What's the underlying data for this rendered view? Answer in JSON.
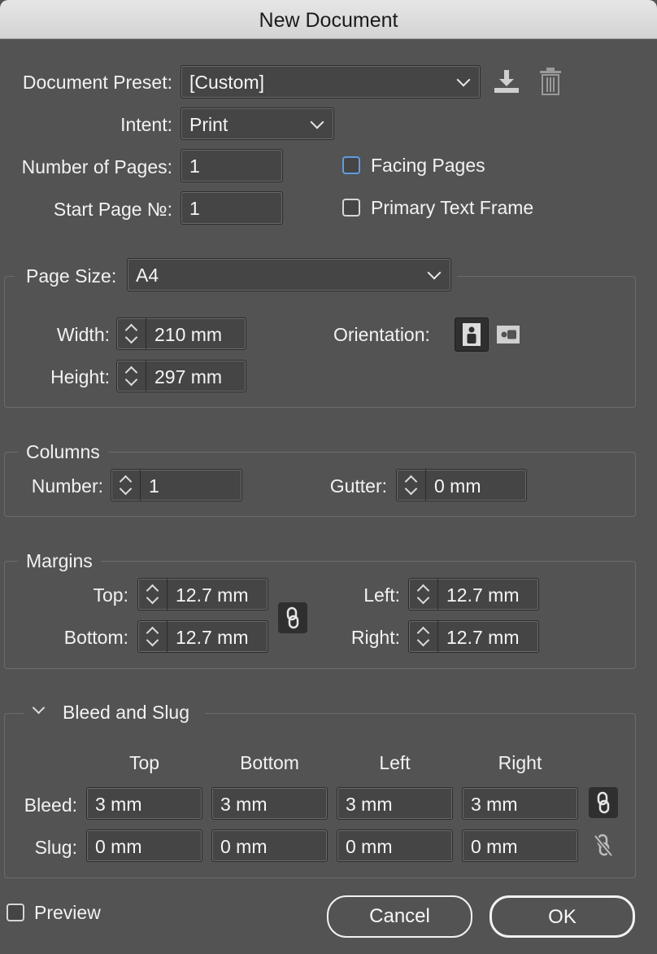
{
  "window": {
    "title": "New Document"
  },
  "preset": {
    "label": "Document Preset:",
    "value": "[Custom]",
    "save_icon": "save-preset-icon",
    "delete_icon": "trash-icon"
  },
  "intent": {
    "label": "Intent:",
    "value": "Print"
  },
  "pages": {
    "label": "Number of Pages:",
    "value": "1"
  },
  "start_page": {
    "label": "Start Page №:",
    "value": "1"
  },
  "facing_pages": {
    "label": "Facing Pages",
    "checked": false
  },
  "primary_text_frame": {
    "label": "Primary Text Frame",
    "checked": false
  },
  "page_size": {
    "label": "Page Size:",
    "value": "A4"
  },
  "width": {
    "label": "Width:",
    "value": "210 mm"
  },
  "height": {
    "label": "Height:",
    "value": "297 mm"
  },
  "orientation": {
    "label": "Orientation:",
    "selected": "portrait"
  },
  "columns": {
    "title": "Columns",
    "number_label": "Number:",
    "number": "1",
    "gutter_label": "Gutter:",
    "gutter": "0 mm"
  },
  "margins": {
    "title": "Margins",
    "top_label": "Top:",
    "top": "12.7 mm",
    "bottom_label": "Bottom:",
    "bottom": "12.7 mm",
    "left_label": "Left:",
    "left": "12.7 mm",
    "right_label": "Right:",
    "right": "12.7 mm",
    "linked": true
  },
  "bleed_slug": {
    "title": "Bleed and Slug",
    "headers": [
      "Top",
      "Bottom",
      "Left",
      "Right"
    ],
    "bleed_label": "Bleed:",
    "bleed": [
      "3 mm",
      "3 mm",
      "3 mm",
      "3 mm"
    ],
    "slug_label": "Slug:",
    "slug": [
      "0 mm",
      "0 mm",
      "0 mm",
      "0 mm"
    ],
    "bleed_linked": true,
    "slug_linked": false
  },
  "preview": {
    "label": "Preview",
    "checked": false
  },
  "buttons": {
    "cancel": "Cancel",
    "ok": "OK"
  }
}
